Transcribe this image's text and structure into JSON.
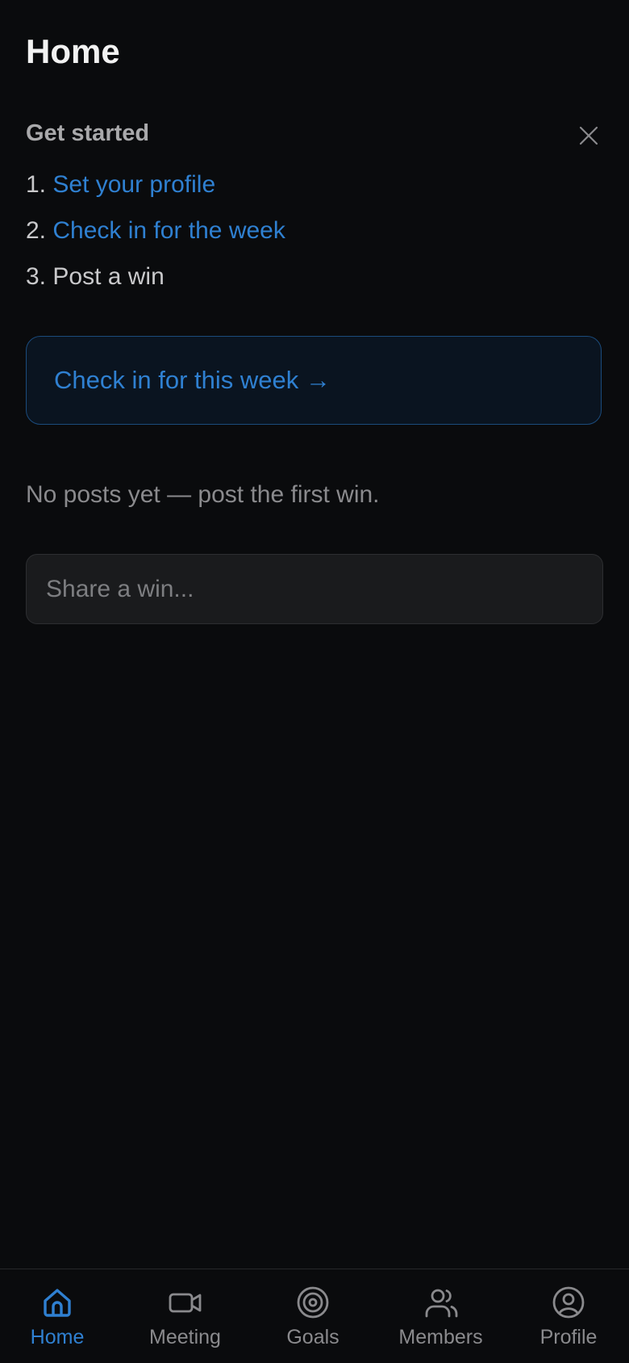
{
  "page": {
    "title": "Home"
  },
  "onboarding": {
    "heading": "Get started",
    "steps": [
      {
        "number": "1.",
        "label": "Set your profile",
        "is_link": true
      },
      {
        "number": "2.",
        "label": "Check in for the week",
        "is_link": true
      },
      {
        "number": "3.",
        "label": "Post a win",
        "is_link": false
      }
    ],
    "close_icon": "close-icon"
  },
  "checkin_card": {
    "label": "Check in for this week →"
  },
  "feed": {
    "empty_message": "No posts yet — post the first win."
  },
  "composer": {
    "placeholder": "Share a win..."
  },
  "tabbar": {
    "tabs": [
      {
        "label": "Home",
        "icon": "home-icon",
        "active": true
      },
      {
        "label": "Meeting",
        "icon": "video-camera-icon",
        "active": false
      },
      {
        "label": "Goals",
        "icon": "target-icon",
        "active": false
      },
      {
        "label": "Members",
        "icon": "users-icon",
        "active": false
      },
      {
        "label": "Profile",
        "icon": "user-circle-icon",
        "active": false
      }
    ]
  },
  "colors": {
    "background": "#0a0b0d",
    "accent": "#2f80d1",
    "muted_text": "#8a8a8d",
    "input_bg": "#1a1b1d"
  }
}
